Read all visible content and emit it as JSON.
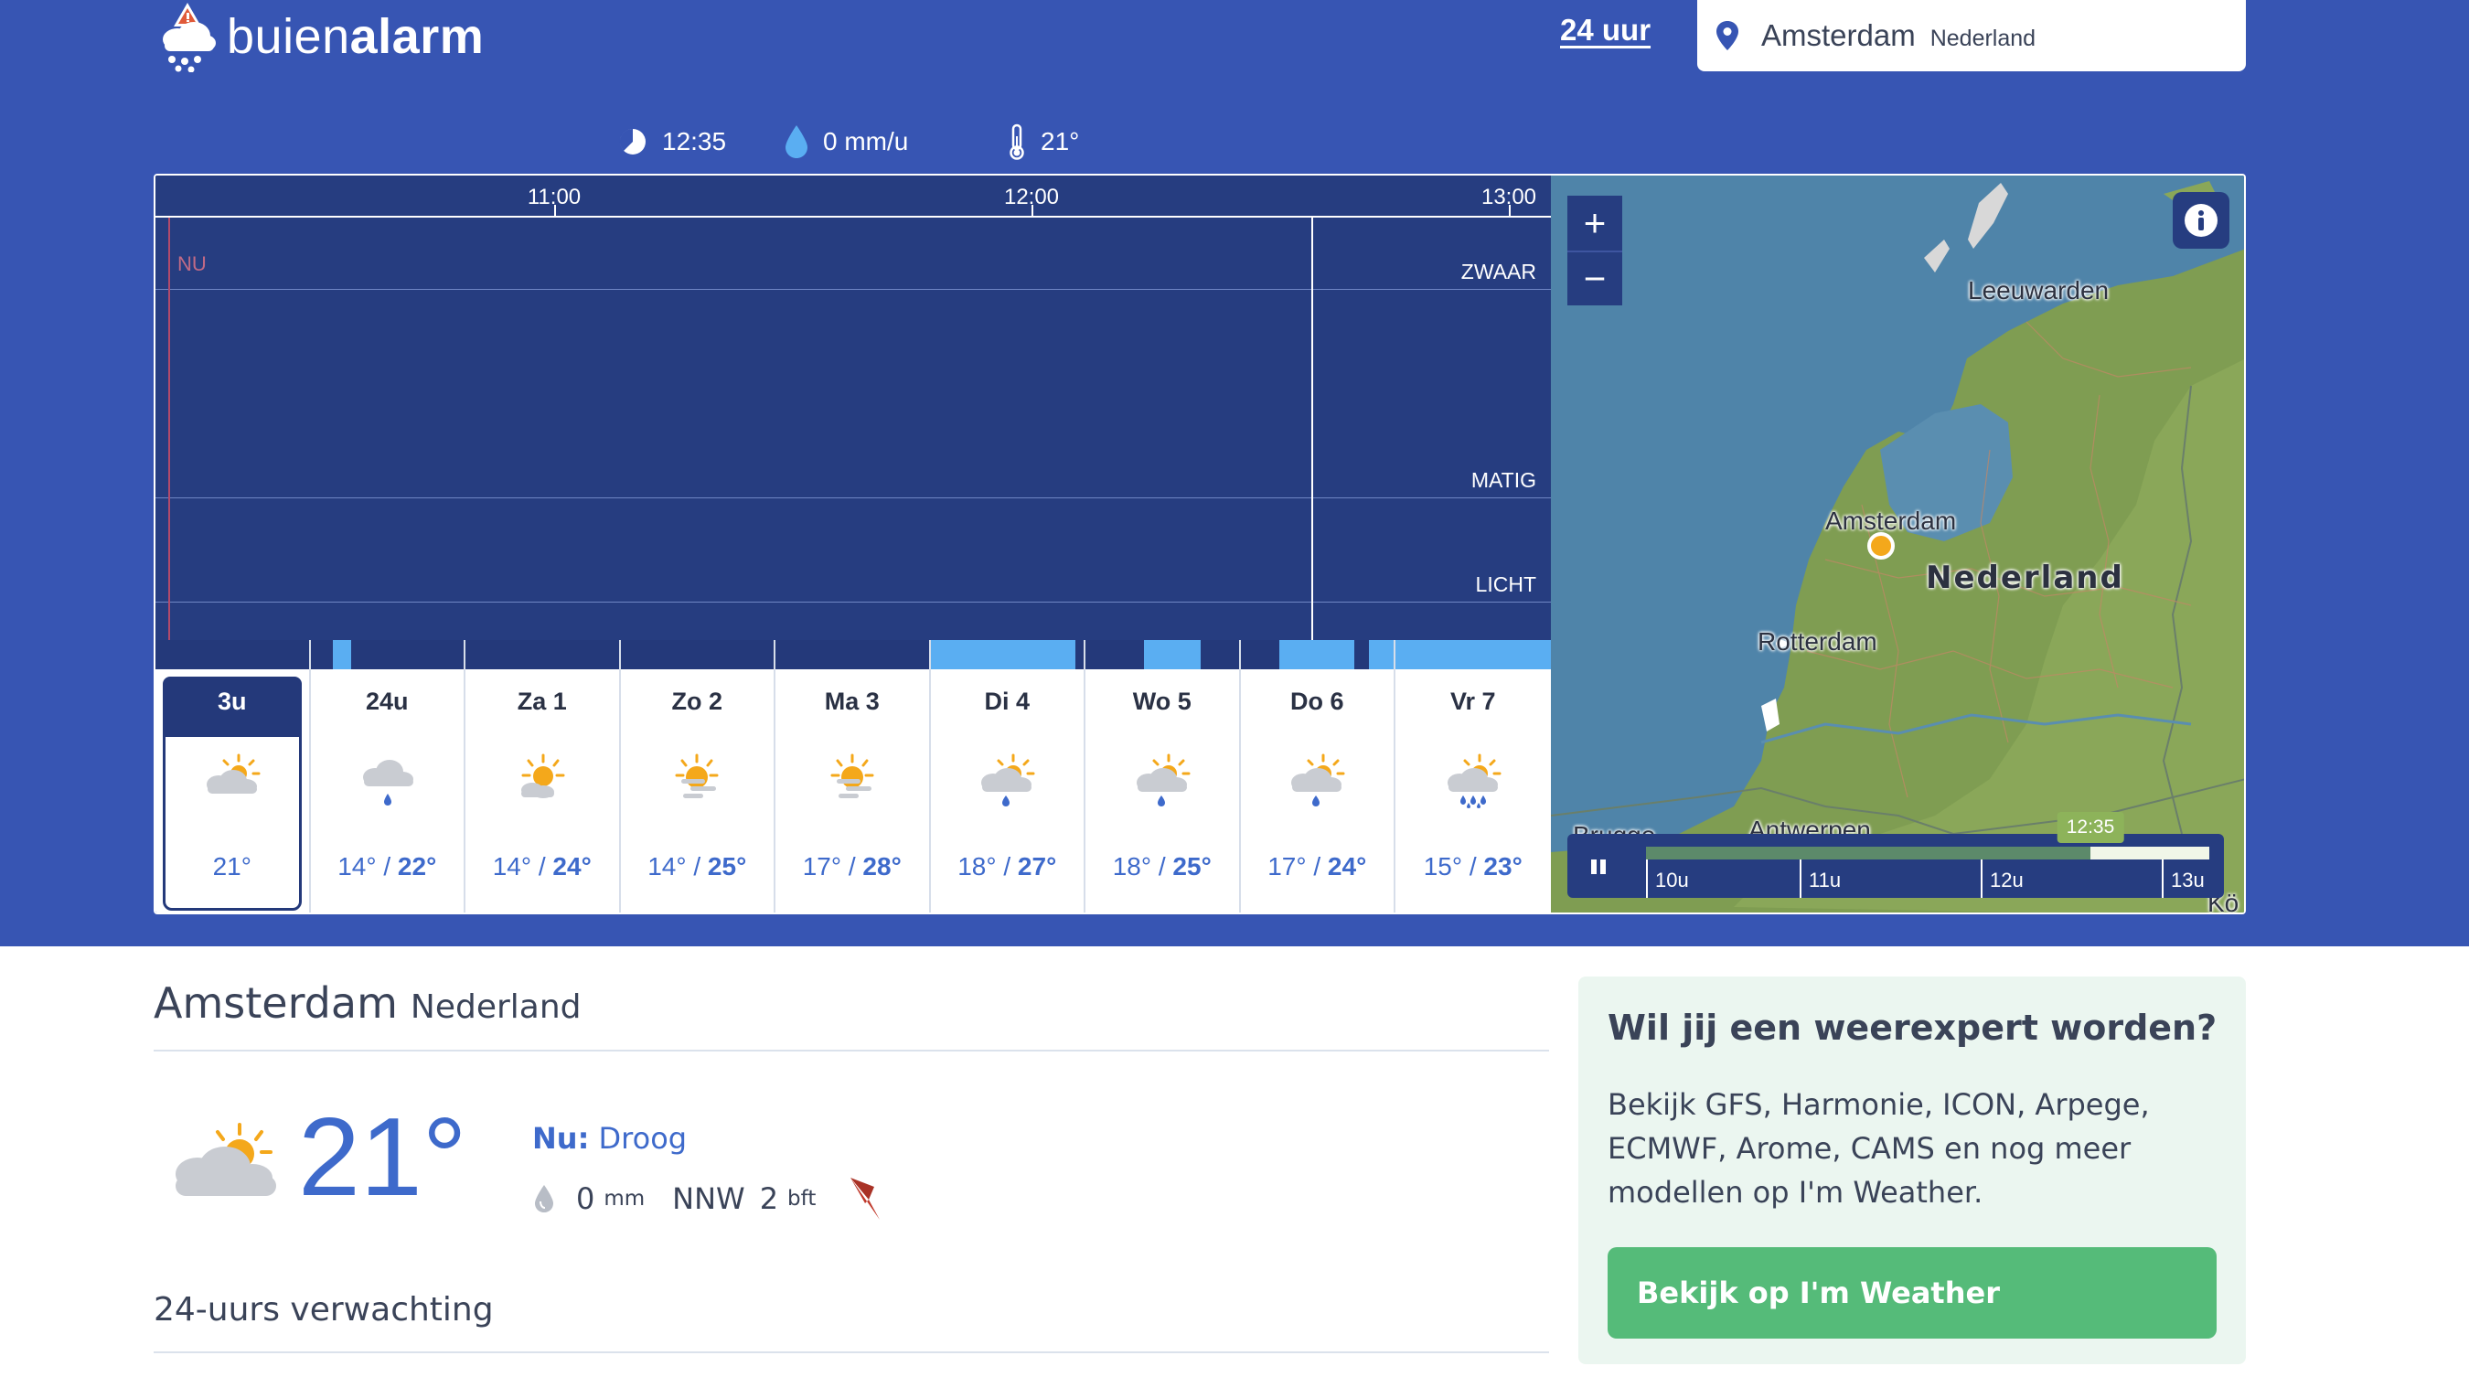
{
  "brand": {
    "name_light": "buien",
    "name_bold": "alarm"
  },
  "nav": {
    "link_24h": "24 uur"
  },
  "location": {
    "city": "Amsterdam",
    "country": "Nederland"
  },
  "status": {
    "time": "12:35",
    "rain": "0 mm/u",
    "temp": "21°"
  },
  "chart": {
    "ticks": [
      "11:00",
      "12:00",
      "13:00"
    ],
    "levels": {
      "heavy": "ZWAAR",
      "moderate": "MATIG",
      "light": "LICHT"
    },
    "now_label": "NU"
  },
  "days": [
    {
      "label": "3u",
      "min": "",
      "max": "21°",
      "icon": "partly-cloudy-icon",
      "selected": true
    },
    {
      "label": "24u",
      "min": "14°",
      "max": "22°",
      "icon": "cloud-rain-icon"
    },
    {
      "label": "Za 1",
      "min": "14°",
      "max": "24°",
      "icon": "sun-cloud-icon"
    },
    {
      "label": "Zo 2",
      "min": "14°",
      "max": "25°",
      "icon": "sun-haze-icon"
    },
    {
      "label": "Ma 3",
      "min": "17°",
      "max": "28°",
      "icon": "sun-haze-icon"
    },
    {
      "label": "Di 4",
      "min": "18°",
      "max": "27°",
      "icon": "sun-cloud-rain-icon"
    },
    {
      "label": "Wo 5",
      "min": "18°",
      "max": "25°",
      "icon": "sun-cloud-rain-icon"
    },
    {
      "label": "Do 6",
      "min": "17°",
      "max": "24°",
      "icon": "sun-cloud-rain-icon"
    },
    {
      "label": "Vr 7",
      "min": "15°",
      "max": "23°",
      "icon": "sun-cloud-heavy-rain-icon"
    }
  ],
  "map": {
    "zoom_in": "+",
    "zoom_out": "−",
    "cities": {
      "leeuwarden": "Leeuwarden",
      "amsterdam": "Amsterdam",
      "nederland": "Nederland",
      "rotterdam": "Rotterdam",
      "antwerpen": "Antwerpen",
      "brugge": "Brugge",
      "koln": "Kö"
    },
    "timeline": {
      "current": "12:35",
      "labels": [
        "10u",
        "11u",
        "12u",
        "13u"
      ]
    }
  },
  "current": {
    "title_city": "Amsterdam",
    "title_country": "Nederland",
    "temp": "21°",
    "desc_label": "Nu:",
    "desc_value": "Droog",
    "rain_value": "0",
    "rain_unit": "mm",
    "wind_dir": "NNW",
    "wind_force": "2",
    "wind_unit": "bft"
  },
  "forecast_title": "24-uurs verwachting",
  "promo": {
    "title": "Wil jij een weerexpert worden?",
    "text": "Bekijk GFS, Harmonie, ICON, Arpege, ECMWF, Arome, CAMS en nog meer modellen op I'm Weather.",
    "button": "Bekijk op I'm Weather"
  },
  "colors": {
    "band": "#3755b3",
    "chart_bg": "#263d80",
    "accent_blue": "#3e6acb",
    "rain_bar": "#5aaef2",
    "promo_bg": "#ebf6f0",
    "promo_button": "#55bb79"
  }
}
